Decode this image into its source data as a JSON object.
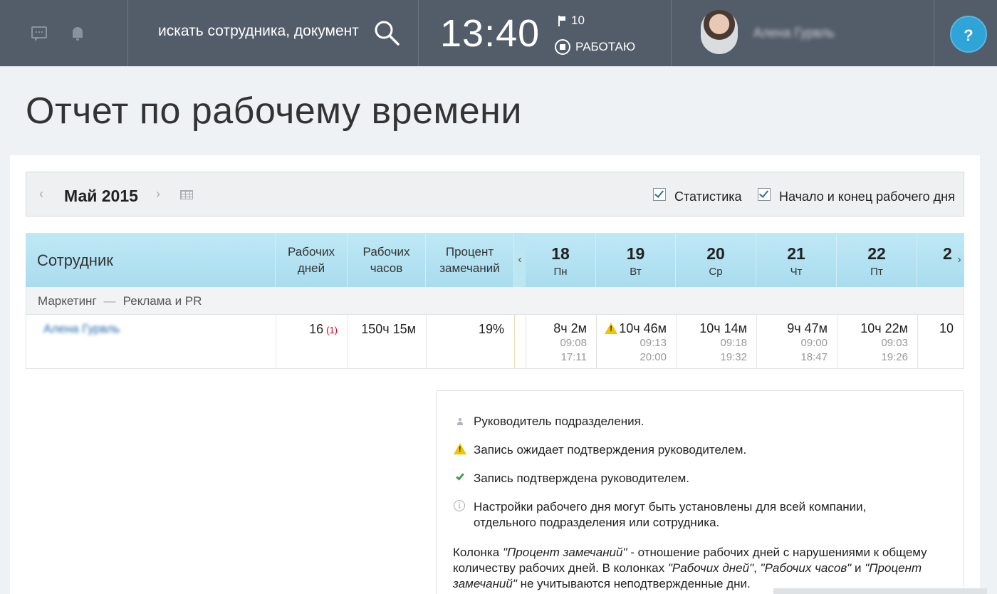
{
  "header": {
    "search_placeholder": "искать сотрудника, документ",
    "clock": "13:40",
    "tasks_count": "10",
    "work_status": "РАБОТАЮ",
    "user_name": "Алена Гурвль",
    "help_label": "?"
  },
  "page": {
    "title": "Отчет по рабочему времени"
  },
  "filter": {
    "month": "Май 2015",
    "prev_label": "‹",
    "next_label": "›",
    "checkbox_stats": "Статистика",
    "checkbox_startend": "Начало и конец рабочего дня"
  },
  "table": {
    "col_employee": "Сотрудник",
    "col_workdays": "Рабочих дней",
    "col_workhours": "Рабочих часов",
    "col_violations": "Процент замечаний",
    "scroll_left": "‹",
    "scroll_right": "›",
    "days": [
      {
        "num": "18",
        "wd": "Пн"
      },
      {
        "num": "19",
        "wd": "Вт"
      },
      {
        "num": "20",
        "wd": "Ср"
      },
      {
        "num": "21",
        "wd": "Чт"
      },
      {
        "num": "22",
        "wd": "Пт"
      },
      {
        "num": "2",
        "wd": ""
      }
    ],
    "department": {
      "name": "Маркетинг",
      "dash": "—",
      "sub": "Реклама и PR"
    },
    "row": {
      "employee": "Алена Гурвль",
      "workdays": "16",
      "workdays_unconfirmed": "(1)",
      "workhours": "150ч 15м",
      "violations": "19%",
      "days": [
        {
          "total": "8ч 2м",
          "start": "09:08",
          "end": "17:11",
          "warn": false
        },
        {
          "total": "10ч 46м",
          "start": "09:13",
          "end": "20:00",
          "warn": true
        },
        {
          "total": "10ч 14м",
          "start": "09:18",
          "end": "19:32",
          "warn": false
        },
        {
          "total": "9ч 47м",
          "start": "09:00",
          "end": "18:47",
          "warn": false
        },
        {
          "total": "10ч 22м",
          "start": "09:03",
          "end": "19:26",
          "warn": false
        },
        {
          "total": "10",
          "start": "",
          "end": "",
          "warn": false
        }
      ]
    }
  },
  "legend": {
    "items": [
      {
        "icon": "person-icon",
        "text": "Руководитель подразделения."
      },
      {
        "icon": "warning-icon",
        "text": "Запись ожидает подтверждения руководителем."
      },
      {
        "icon": "check-icon",
        "text": "Запись подтверждена руководителем."
      },
      {
        "icon": "info-icon",
        "text": "Настройки рабочего дня могут быть установлены для всей компании,",
        "text2": "отдельного подразделения или сотрудника."
      }
    ],
    "note": {
      "p1": "Колонка ",
      "q1": "\"Процент замечаний\"",
      "p2": " - отношение рабочих дней с нарушениями к общему количеству рабочих дней. В колонках ",
      "q2": "\"Рабочих дней\"",
      "p3": ", ",
      "q3": "\"Рабочих часов\"",
      "p4": " и ",
      "q4": "\"Процент замечаний\"",
      "p5": " не учитываются неподтвержденные дни."
    }
  }
}
